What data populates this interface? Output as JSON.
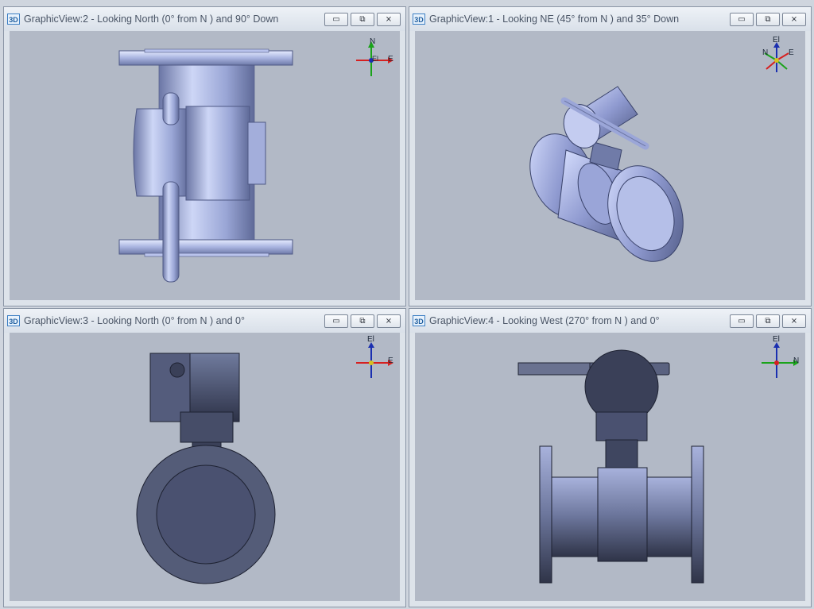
{
  "views": [
    {
      "icon": "3D",
      "title": "GraphicView:2 - Looking North (0° from N ) and 90° Down",
      "axes": {
        "up": "N",
        "right": "E",
        "center": "El"
      }
    },
    {
      "icon": "3D",
      "title": "GraphicView:1 - Looking NE (45° from N ) and 35° Down",
      "axes": {
        "up": "El",
        "right": "E",
        "left": "N"
      }
    },
    {
      "icon": "3D",
      "title": "GraphicView:3 - Looking North (0° from N ) and 0°",
      "axes": {
        "up": "El",
        "right": "E"
      }
    },
    {
      "icon": "3D",
      "title": "GraphicView:4 - Looking West (270° from N ) and 0°",
      "axes": {
        "up": "El",
        "right": "N"
      }
    }
  ],
  "window_buttons": {
    "minimize": "▭",
    "restore": "⧉",
    "close": "⨯"
  },
  "colors": {
    "viewport_bg": "#b2b9c6",
    "model_metal": "#8e99c5",
    "x_axis": "#d62020",
    "y_axis": "#1aa31a",
    "z_axis": "#1a2fb0"
  }
}
